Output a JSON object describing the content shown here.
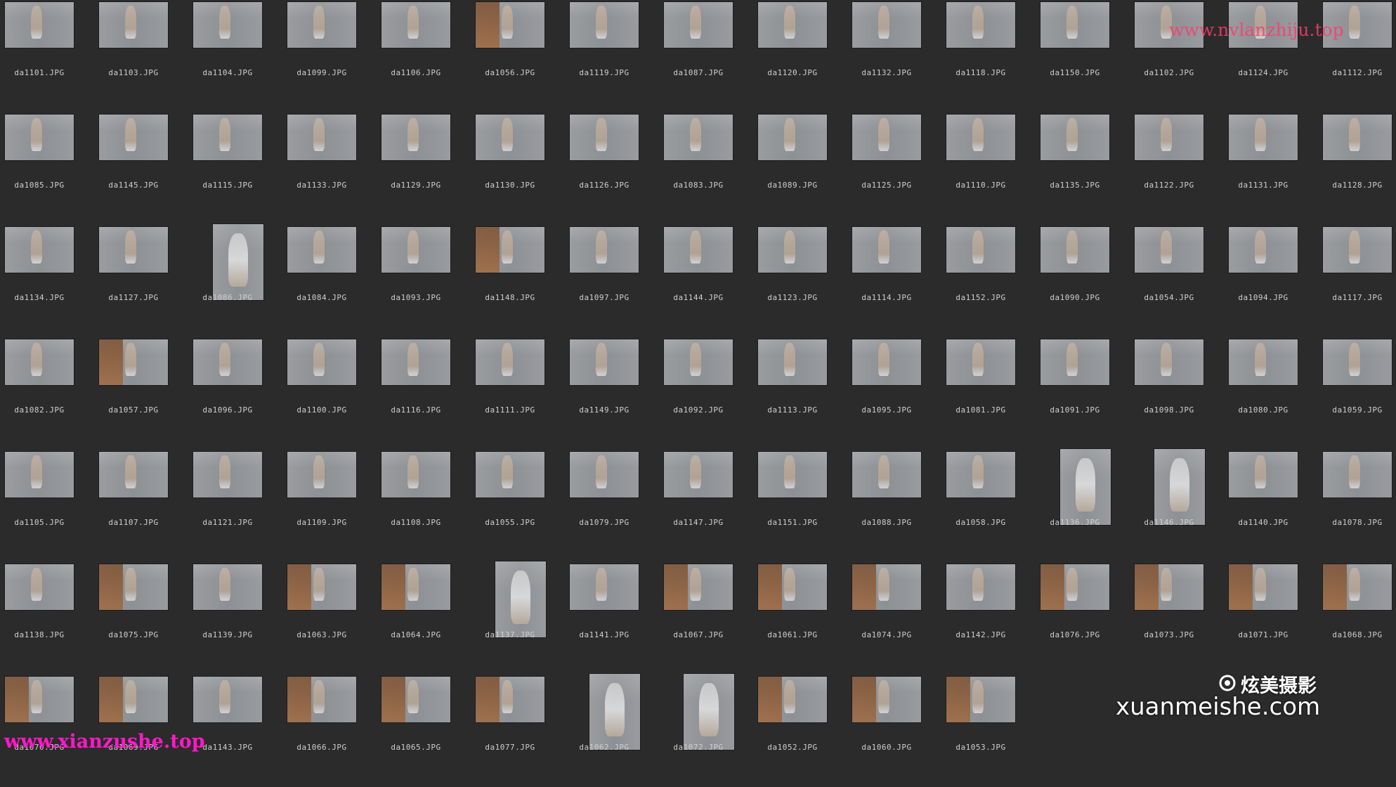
{
  "rows": [
    [
      "da1101.JPG",
      "da1103.JPG",
      "da1104.JPG",
      "da1099.JPG",
      "da1106.JPG",
      "da1056.JPG",
      "da1119.JPG",
      "da1087.JPG",
      "da1120.JPG",
      "da1132.JPG",
      "da1118.JPG",
      "da1150.JPG",
      "da1102.JPG",
      "da1124.JPG",
      "da1112.JPG"
    ],
    [
      "da1085.JPG",
      "da1145.JPG",
      "da1115.JPG",
      "da1133.JPG",
      "da1129.JPG",
      "da1130.JPG",
      "da1126.JPG",
      "da1083.JPG",
      "da1089.JPG",
      "da1125.JPG",
      "da1110.JPG",
      "da1135.JPG",
      "da1122.JPG",
      "da1131.JPG",
      "da1128.JPG"
    ],
    [
      "da1134.JPG",
      "da1127.JPG",
      "da1086.JPG",
      "da1084.JPG",
      "da1093.JPG",
      "da1148.JPG",
      "da1097.JPG",
      "da1144.JPG",
      "da1123.JPG",
      "da1114.JPG",
      "da1152.JPG",
      "da1090.JPG",
      "da1054.JPG",
      "da1094.JPG",
      "da1117.JPG"
    ],
    [
      "da1082.JPG",
      "da1057.JPG",
      "da1096.JPG",
      "da1100.JPG",
      "da1116.JPG",
      "da1111.JPG",
      "da1149.JPG",
      "da1092.JPG",
      "da1113.JPG",
      "da1095.JPG",
      "da1081.JPG",
      "da1091.JPG",
      "da1098.JPG",
      "da1080.JPG",
      "da1059.JPG"
    ],
    [
      "da1105.JPG",
      "da1107.JPG",
      "da1121.JPG",
      "da1109.JPG",
      "da1108.JPG",
      "da1055.JPG",
      "da1079.JPG",
      "da1147.JPG",
      "da1151.JPG",
      "da1088.JPG",
      "da1058.JPG",
      "da1136.JPG",
      "da1146.JPG",
      "da1140.JPG",
      "da1078.JPG"
    ],
    [
      "da1138.JPG",
      "da1075.JPG",
      "da1139.JPG",
      "da1063.JPG",
      "da1064.JPG",
      "da1137.JPG",
      "da1141.JPG",
      "da1067.JPG",
      "da1061.JPG",
      "da1074.JPG",
      "da1142.JPG",
      "da1076.JPG",
      "da1073.JPG",
      "da1071.JPG",
      "da1068.JPG"
    ],
    [
      "da1070.JPG",
      "da1069.JPG",
      "da1143.JPG",
      "da1066.JPG",
      "da1065.JPG",
      "da1077.JPG",
      "da1062.JPG",
      "da1072.JPG",
      "da1052.JPG",
      "da1060.JPG",
      "da1053.JPG"
    ]
  ],
  "portrait": [
    "2-2",
    "4-11",
    "4-12",
    "5-5",
    "6-6",
    "6-7"
  ],
  "wood": [
    "0-5",
    "2-5",
    "3-1",
    "5-1",
    "5-3",
    "5-4",
    "5-7",
    "5-8",
    "5-9",
    "5-11",
    "5-12",
    "5-13",
    "5-14",
    "6-0",
    "6-1",
    "6-3",
    "6-4",
    "6-5",
    "6-8",
    "6-9",
    "6-10"
  ],
  "watermarks": {
    "top": "www.nvlanzhiju.top",
    "bottom": "www.xianzushe.top",
    "brand": "炫美摄影",
    "site": "xuanmeishe.com",
    "brand_color": "#ffffff",
    "top_color": "#ff3b6a",
    "bottom_color": "#ff18c8"
  },
  "colors": {
    "background": "#2b2b2b",
    "label": "#cfcfcf"
  }
}
